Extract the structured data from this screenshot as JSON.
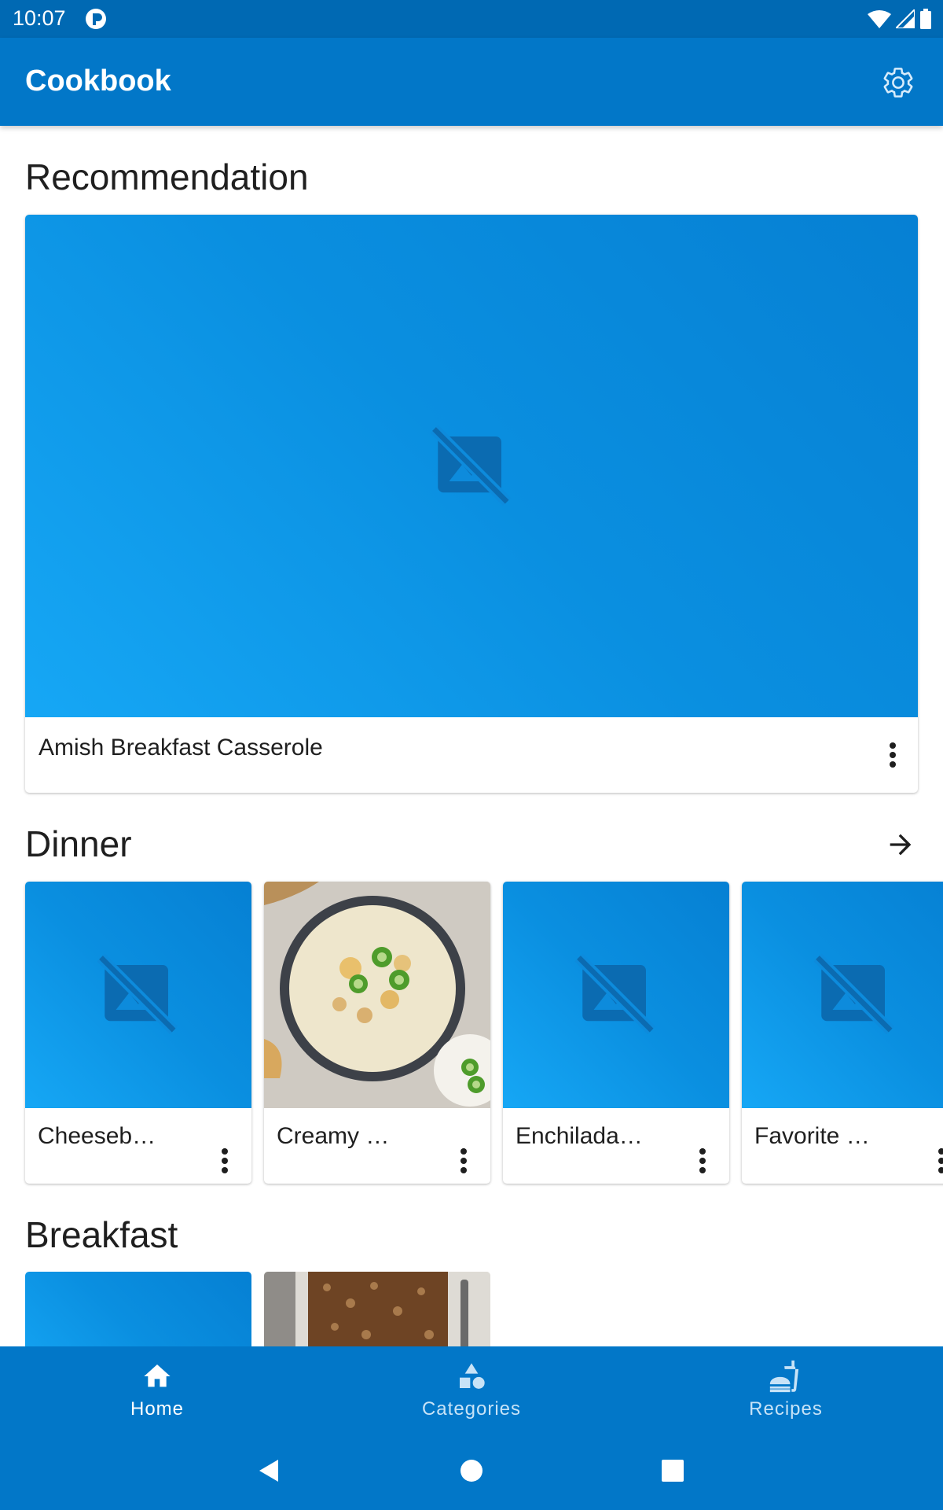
{
  "status_bar": {
    "time": "10:07"
  },
  "app_bar": {
    "title": "Cookbook"
  },
  "sections": {
    "recommendation": {
      "title": "Recommendation",
      "card": {
        "title": "Amish Breakfast Casserole",
        "image": "placeholder"
      }
    },
    "dinner": {
      "title": "Dinner",
      "cards": [
        {
          "title": "Cheeseb…",
          "image": "placeholder"
        },
        {
          "title": "Creamy …",
          "image": "soup-photo"
        },
        {
          "title": "Enchilada…",
          "image": "placeholder"
        },
        {
          "title": "Favorite …",
          "image": "placeholder"
        }
      ]
    },
    "breakfast": {
      "title": "Breakfast",
      "cards": [
        {
          "image": "placeholder"
        },
        {
          "image": "bread-photo"
        }
      ]
    }
  },
  "bottom_nav": {
    "items": [
      {
        "label": "Home",
        "icon": "home-icon",
        "active": true
      },
      {
        "label": "Categories",
        "icon": "shapes-icon",
        "active": false
      },
      {
        "label": "Recipes",
        "icon": "fastfood-icon",
        "active": false
      }
    ]
  },
  "system_nav": [
    "back-icon",
    "home-circle-icon",
    "recents-icon"
  ],
  "colors": {
    "primary": "#0277c8",
    "status_bar": "#0069b3",
    "placeholder_light": "#16a7f5",
    "placeholder_dark": "#0680d3",
    "nav_inactive_label": "#c7e3f7"
  }
}
